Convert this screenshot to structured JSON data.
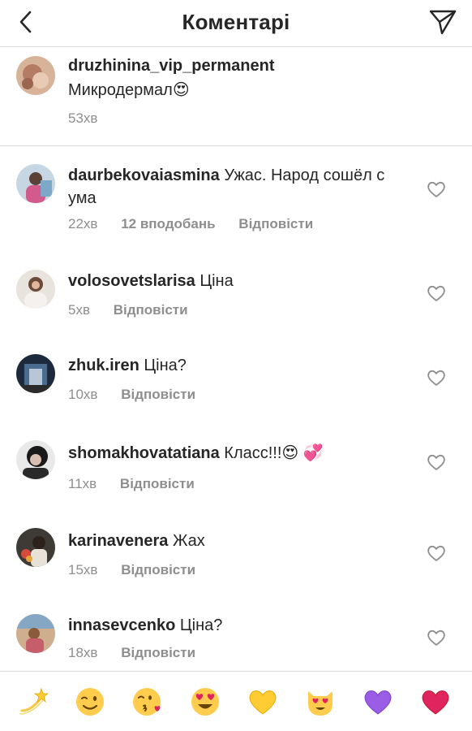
{
  "header": {
    "title": "Коментарі",
    "back_icon": "chevron-left-icon",
    "send_icon": "paper-plane-icon"
  },
  "caption": {
    "username": "druzhinina_vip_permanent",
    "text": "Микродермал",
    "emoji": "😍",
    "time": "53хв"
  },
  "comments": [
    {
      "username": "daurbekovaiasmina",
      "text": "Ужас. Народ сошёл с ума",
      "time": "22хв",
      "likes": "12 вподобань",
      "reply": "Відповісти"
    },
    {
      "username": "volosovetslarisa",
      "text": "Ціна",
      "time": "5хв",
      "reply": "Відповісти"
    },
    {
      "username": "zhuk.iren",
      "text": "Ціна?",
      "time": "10хв",
      "reply": "Відповісти"
    },
    {
      "username": "shomakhovatatiana",
      "text": "Класс!!!",
      "emoji": "😍 💞",
      "time": "11хв",
      "reply": "Відповісти"
    },
    {
      "username": "karinavenera",
      "text": "Жах",
      "time": "15хв",
      "reply": "Відповісти"
    },
    {
      "username": "innasevcenko",
      "text": "Ціна?",
      "time": "18хв",
      "reply": "Відповісти"
    }
  ],
  "emoji_bar": [
    "💫",
    "😉",
    "😘",
    "😍",
    "💛",
    "😻",
    "💜",
    "❤️"
  ],
  "colors": {
    "text": "#262626",
    "muted": "#8e8e8e",
    "divider": "#dbdbdb"
  }
}
